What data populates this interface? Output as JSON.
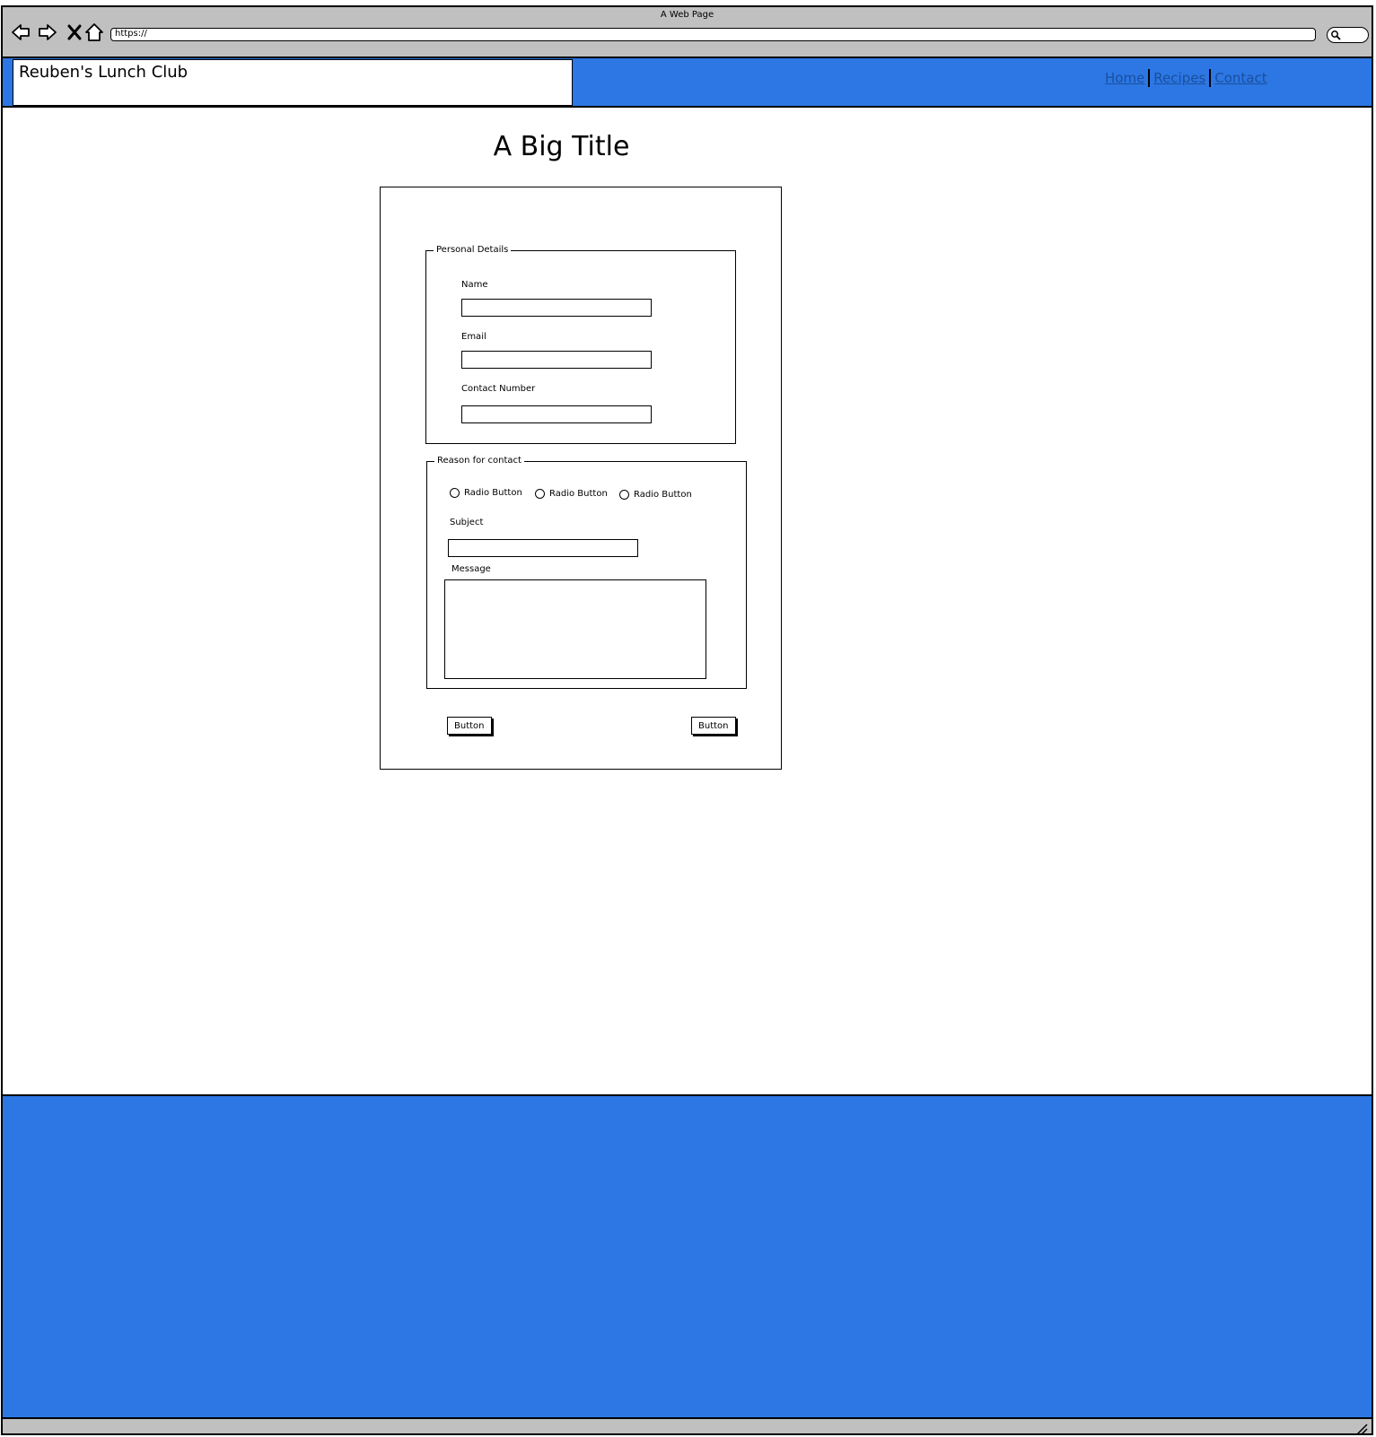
{
  "browser": {
    "window_title": "A Web Page",
    "url": "https://",
    "icons": [
      "back-arrow-icon",
      "forward-arrow-icon",
      "stop-icon",
      "home-icon",
      "search-icon"
    ]
  },
  "header": {
    "brand": "Reuben's Lunch Club",
    "nav": [
      {
        "label": "Home"
      },
      {
        "label": "Recipes"
      },
      {
        "label": "Contact"
      }
    ],
    "colors": {
      "background": "#2c77e4",
      "link": "#1a4f9c"
    }
  },
  "main": {
    "title": "A Big Title",
    "personal_details": {
      "legend": "Personal Details",
      "fields": [
        {
          "label": "Name",
          "value": ""
        },
        {
          "label": "Email",
          "value": ""
        },
        {
          "label": "Contact Number",
          "value": ""
        }
      ]
    },
    "reason": {
      "legend": "Reason for contact",
      "radios": [
        {
          "label": "Radio Button",
          "checked": false
        },
        {
          "label": "Radio Button",
          "checked": false
        },
        {
          "label": "Radio Button",
          "checked": false
        }
      ],
      "subject_label": "Subject",
      "subject_value": "",
      "message_label": "Message",
      "message_value": ""
    },
    "buttons": {
      "left": "Button",
      "right": "Button"
    }
  },
  "footer": {
    "color": "#2c77e4"
  }
}
